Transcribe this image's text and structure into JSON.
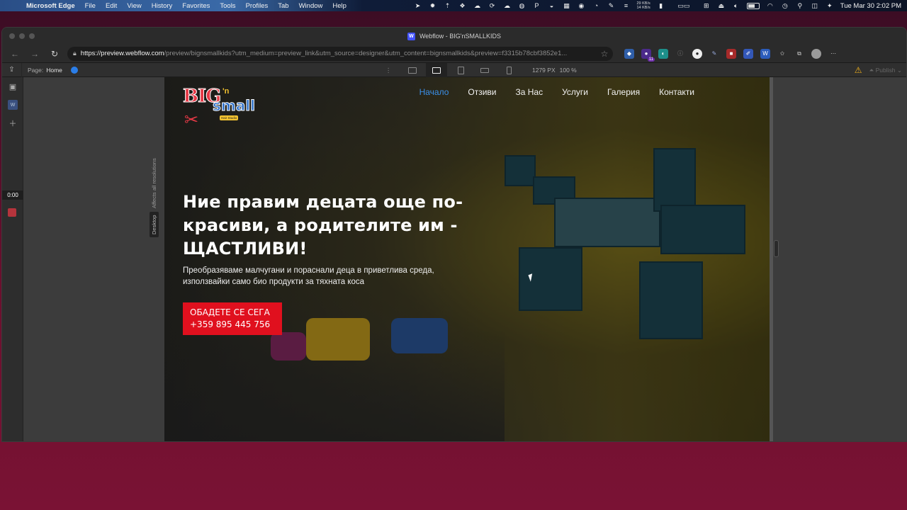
{
  "menubar": {
    "app": "Microsoft Edge",
    "items": [
      "File",
      "Edit",
      "View",
      "History",
      "Favorites",
      "Tools",
      "Profiles",
      "Tab",
      "Window",
      "Help"
    ],
    "net_up": "29 KB/s",
    "net_down": "14 KB/s",
    "clock": "Tue Mar 30  2:02 PM"
  },
  "window": {
    "title": "Webflow - BIG'nSMALLKIDS"
  },
  "address": {
    "host": "https://preview.webflow.com",
    "rest": "/preview/bignsmallkids?utm_medium=preview_link&utm_source=designer&utm_content=bignsmallkids&preview=f3315b78cbf3852e1..."
  },
  "wfbar": {
    "page_label": "Page:",
    "page_value": "Home",
    "width": "1279",
    "width_unit": "PX",
    "zoom": "100 %",
    "publish": "Publish"
  },
  "designer": {
    "timer": "0:00",
    "desktop_label": "Desktop",
    "affects_label": "Affects all resolutions"
  },
  "site": {
    "logo": {
      "big": "BIG",
      "n": "'n",
      "small": "small",
      "studio": "Hair Studio"
    },
    "nav": [
      "Начало",
      "Отзиви",
      "За Нас",
      "Услуги",
      "Галерия",
      "Контакти"
    ],
    "hero_title": "Ние правим децата още по-красиви, а родителите им - ЩАСТЛИВИ!",
    "hero_sub": "Преобразяваме малчугани и пораснали деца в приветлива среда, използвайки само био продукти за тяхната коса",
    "cta_line1": "ОБАДЕТЕ СЕ СЕГА",
    "cta_line2": "+359 895 445 756"
  },
  "colors": {
    "nav_current": "#3a8fe8",
    "cta": "#e0101e",
    "webflow_blue": "#4353ff"
  }
}
